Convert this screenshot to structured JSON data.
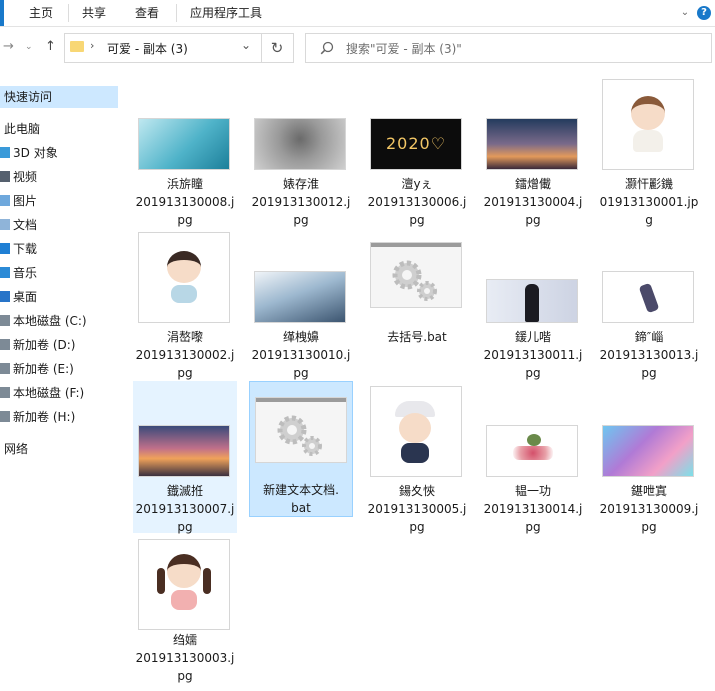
{
  "ribbon": {
    "tabs": [
      "主页",
      "共享",
      "查看",
      "应用程序工具"
    ]
  },
  "address": {
    "path": "可爱 - 副本 (3)",
    "search_placeholder": "搜索\"可爱 - 副本 (3)\""
  },
  "sidebar": {
    "items": [
      {
        "label": "快速访问",
        "icon": "star-icon"
      },
      {
        "label": "此电脑",
        "icon": "computer-icon"
      },
      {
        "label": "3D 对象",
        "icon": "cube-icon"
      },
      {
        "label": "视频",
        "icon": "video-icon"
      },
      {
        "label": "图片",
        "icon": "picture-icon"
      },
      {
        "label": "文档",
        "icon": "document-icon"
      },
      {
        "label": "下载",
        "icon": "download-icon"
      },
      {
        "label": "音乐",
        "icon": "music-icon"
      },
      {
        "label": "桌面",
        "icon": "desktop-icon"
      },
      {
        "label": "本地磁盘 (C:)",
        "icon": "drive-icon"
      },
      {
        "label": "新加卷 (D:)",
        "icon": "drive-icon"
      },
      {
        "label": "新加卷 (E:)",
        "icon": "drive-icon"
      },
      {
        "label": "本地磁盘 (F:)",
        "icon": "drive-icon"
      },
      {
        "label": "新加卷 (H:)",
        "icon": "drive-icon"
      },
      {
        "label": "网络",
        "icon": "network-icon"
      }
    ]
  },
  "files": [
    {
      "name": "浜旂瞳",
      "line2": "201913130008.j",
      "line3": "pg",
      "thumb": "ocean-diver"
    },
    {
      "name": "婊存淮",
      "line2": "201913130012.j",
      "line3": "pg",
      "thumb": "hooded-figure"
    },
    {
      "name": "澶уぇ",
      "line2": "201913130006.j",
      "line3": "pg",
      "thumb": "2020-sparkler"
    },
    {
      "name": "鐳熷儎",
      "line2": "201913130004.j",
      "line3": "pg",
      "thumb": "girl-sunset"
    },
    {
      "name": "灏忓彲鐖",
      "line2": "01913130001.jp",
      "line3": "g",
      "thumb": "cartoon-boy"
    },
    {
      "name": "涓嶅嚟",
      "line2": "201913130002.j",
      "line3": "pg",
      "thumb": "cartoon-girl-pigtails"
    },
    {
      "name": "缂栧嬶",
      "line2": "201913130010.j",
      "line3": "pg",
      "thumb": "girl-winter"
    },
    {
      "name": "去括号.bat",
      "line2": "",
      "line3": "",
      "thumb": "bat-gear"
    },
    {
      "name": "鍰儿喈",
      "line2": "201913130011.j",
      "line3": "pg",
      "thumb": "girl-dark"
    },
    {
      "name": "鍗″崰",
      "line2": "201913130013.j",
      "line3": "pg",
      "thumb": "small-figure"
    },
    {
      "name": "鐡滅拰",
      "line2": "201913130007.j",
      "line3": "pg",
      "thumb": "sunset-station"
    },
    {
      "name": "新建文本文档.",
      "line2": "bat",
      "line3": "",
      "thumb": "bat-gear"
    },
    {
      "name": "鍚夊悏",
      "line2": "201913130005.j",
      "line3": "pg",
      "thumb": "cartoon-boy-cap"
    },
    {
      "name": "韫一功",
      "line2": "201913130014.j",
      "line3": "pg",
      "thumb": "flowers-pot"
    },
    {
      "name": "鍖呭寘",
      "line2": "201913130009.j",
      "line3": "pg",
      "thumb": "colorful-town"
    },
    {
      "name": "绉嬬",
      "line2": "201913130003.j",
      "line3": "pg",
      "thumb": "cartoon-girl-braids"
    }
  ]
}
